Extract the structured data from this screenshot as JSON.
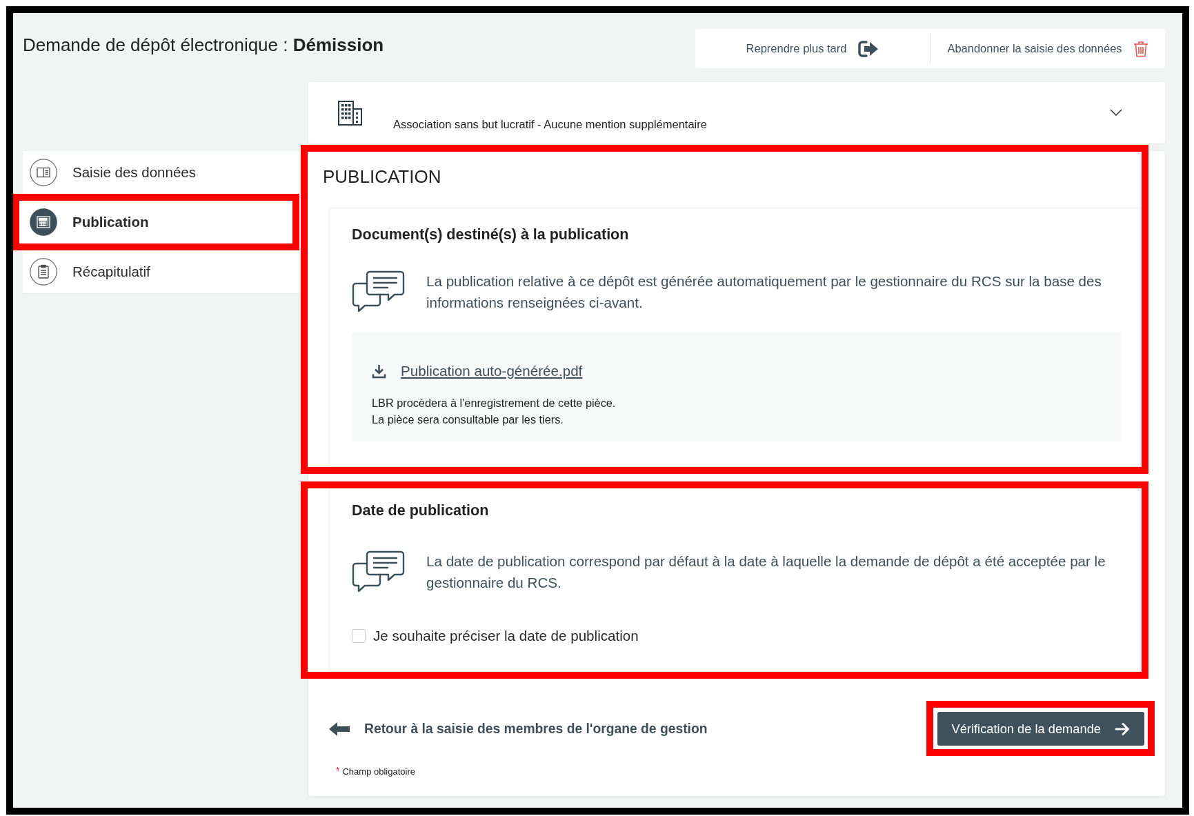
{
  "header": {
    "title": "Demande de dépôt électronique : **Démission**",
    "actions": [
      {
        "kind": "resume",
        "label": "Reprendre plus tard"
      },
      {
        "kind": "abandon",
        "label": "Abandonner la saisie des données"
      }
    ]
  },
  "entity_bar": {
    "label": "Association sans but lucratif - Aucune mention supplémentaire",
    "expanded": false
  },
  "steps": [
    {
      "kind": "form",
      "label": "Saisie des données",
      "selected": false,
      "highlighted": false
    },
    {
      "kind": "publication",
      "label": "Publication",
      "selected": true,
      "highlighted": true
    },
    {
      "kind": "summary",
      "label": "Récapitulatif",
      "selected": false,
      "highlighted": false
    }
  ],
  "panel": {
    "groups": [
      {
        "highlighted": true,
        "title": "PUBLICATION",
        "sections": [
          {
            "title": "Document(s) destiné(s) à la publication",
            "info": "La publication relative à ce dépôt est générée automatiquement par le gestionnaire du RCS sur la base des informations renseignées ci-avant.",
            "document": {
              "link": "Publication auto-générée.pdf",
              "notes": [
                "LBR procèdera à l'enregistrement de cette pièce.",
                "La pièce sera consultable par les tiers."
              ]
            }
          }
        ]
      },
      {
        "highlighted": true,
        "sections": [
          {
            "title": "Date de publication",
            "info": "La date de publication correspond par défaut à la date à laquelle la demande de dépôt a été acceptée par le gestionnaire du RCS.",
            "checkbox": {
              "label": "Je souhaite préciser la date de publication",
              "checked": false
            }
          }
        ]
      }
    ],
    "back_link": "Retour à la saisie des membres de l'organe de gestion",
    "next_button": {
      "label": "Vérification de la demande",
      "highlighted": true
    },
    "required_note": {
      "mark": "*",
      "text": "Champ obligatoire"
    }
  }
}
